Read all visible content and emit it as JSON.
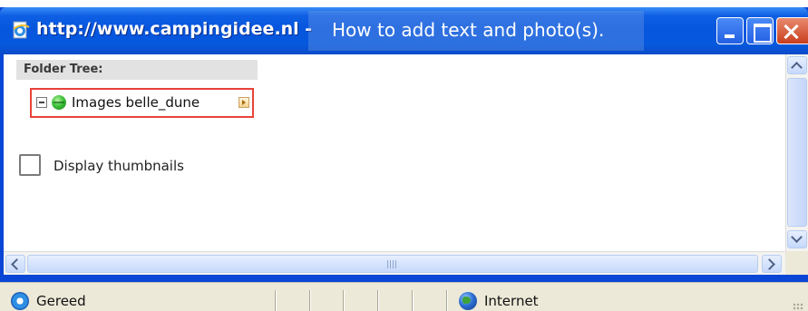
{
  "window": {
    "title": "http://www.campingidee.nl -",
    "overlay_caption": "How to add text and photo(s)."
  },
  "folder_tree": {
    "header": "Folder Tree:",
    "node_label": "Images belle_dune"
  },
  "options": {
    "display_thumbnails_label": "Display thumbnails",
    "display_thumbnails_checked": false
  },
  "status_bar": {
    "status_text": "Gereed",
    "zone_text": "Internet"
  },
  "icons": {
    "title": "ie-page-icon",
    "tree_node": "green-globe-icon",
    "status": "ie-icon",
    "zone": "internet-globe-icon"
  }
}
